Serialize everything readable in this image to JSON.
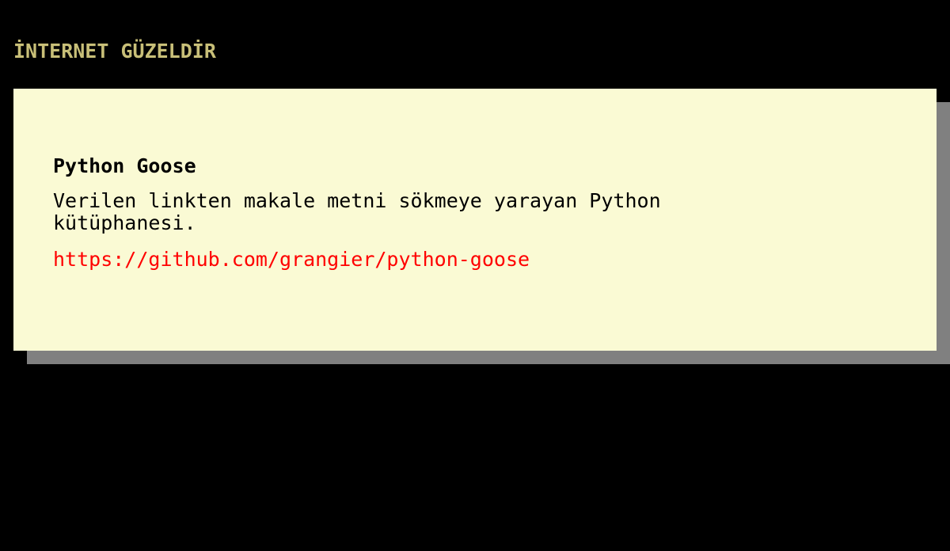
{
  "header": {
    "title": "İNTERNET GÜZELDİR"
  },
  "card": {
    "title": "Python Goose",
    "description": "Verilen linkten makale metni sökmeye yarayan Python kütüphanesi.",
    "link": "https://github.com/grangier/python-goose"
  },
  "colors": {
    "background": "#000000",
    "title": "#c8bf78",
    "card_background": "#fafad4",
    "card_shadow": "#808080",
    "link": "#ff0000"
  }
}
